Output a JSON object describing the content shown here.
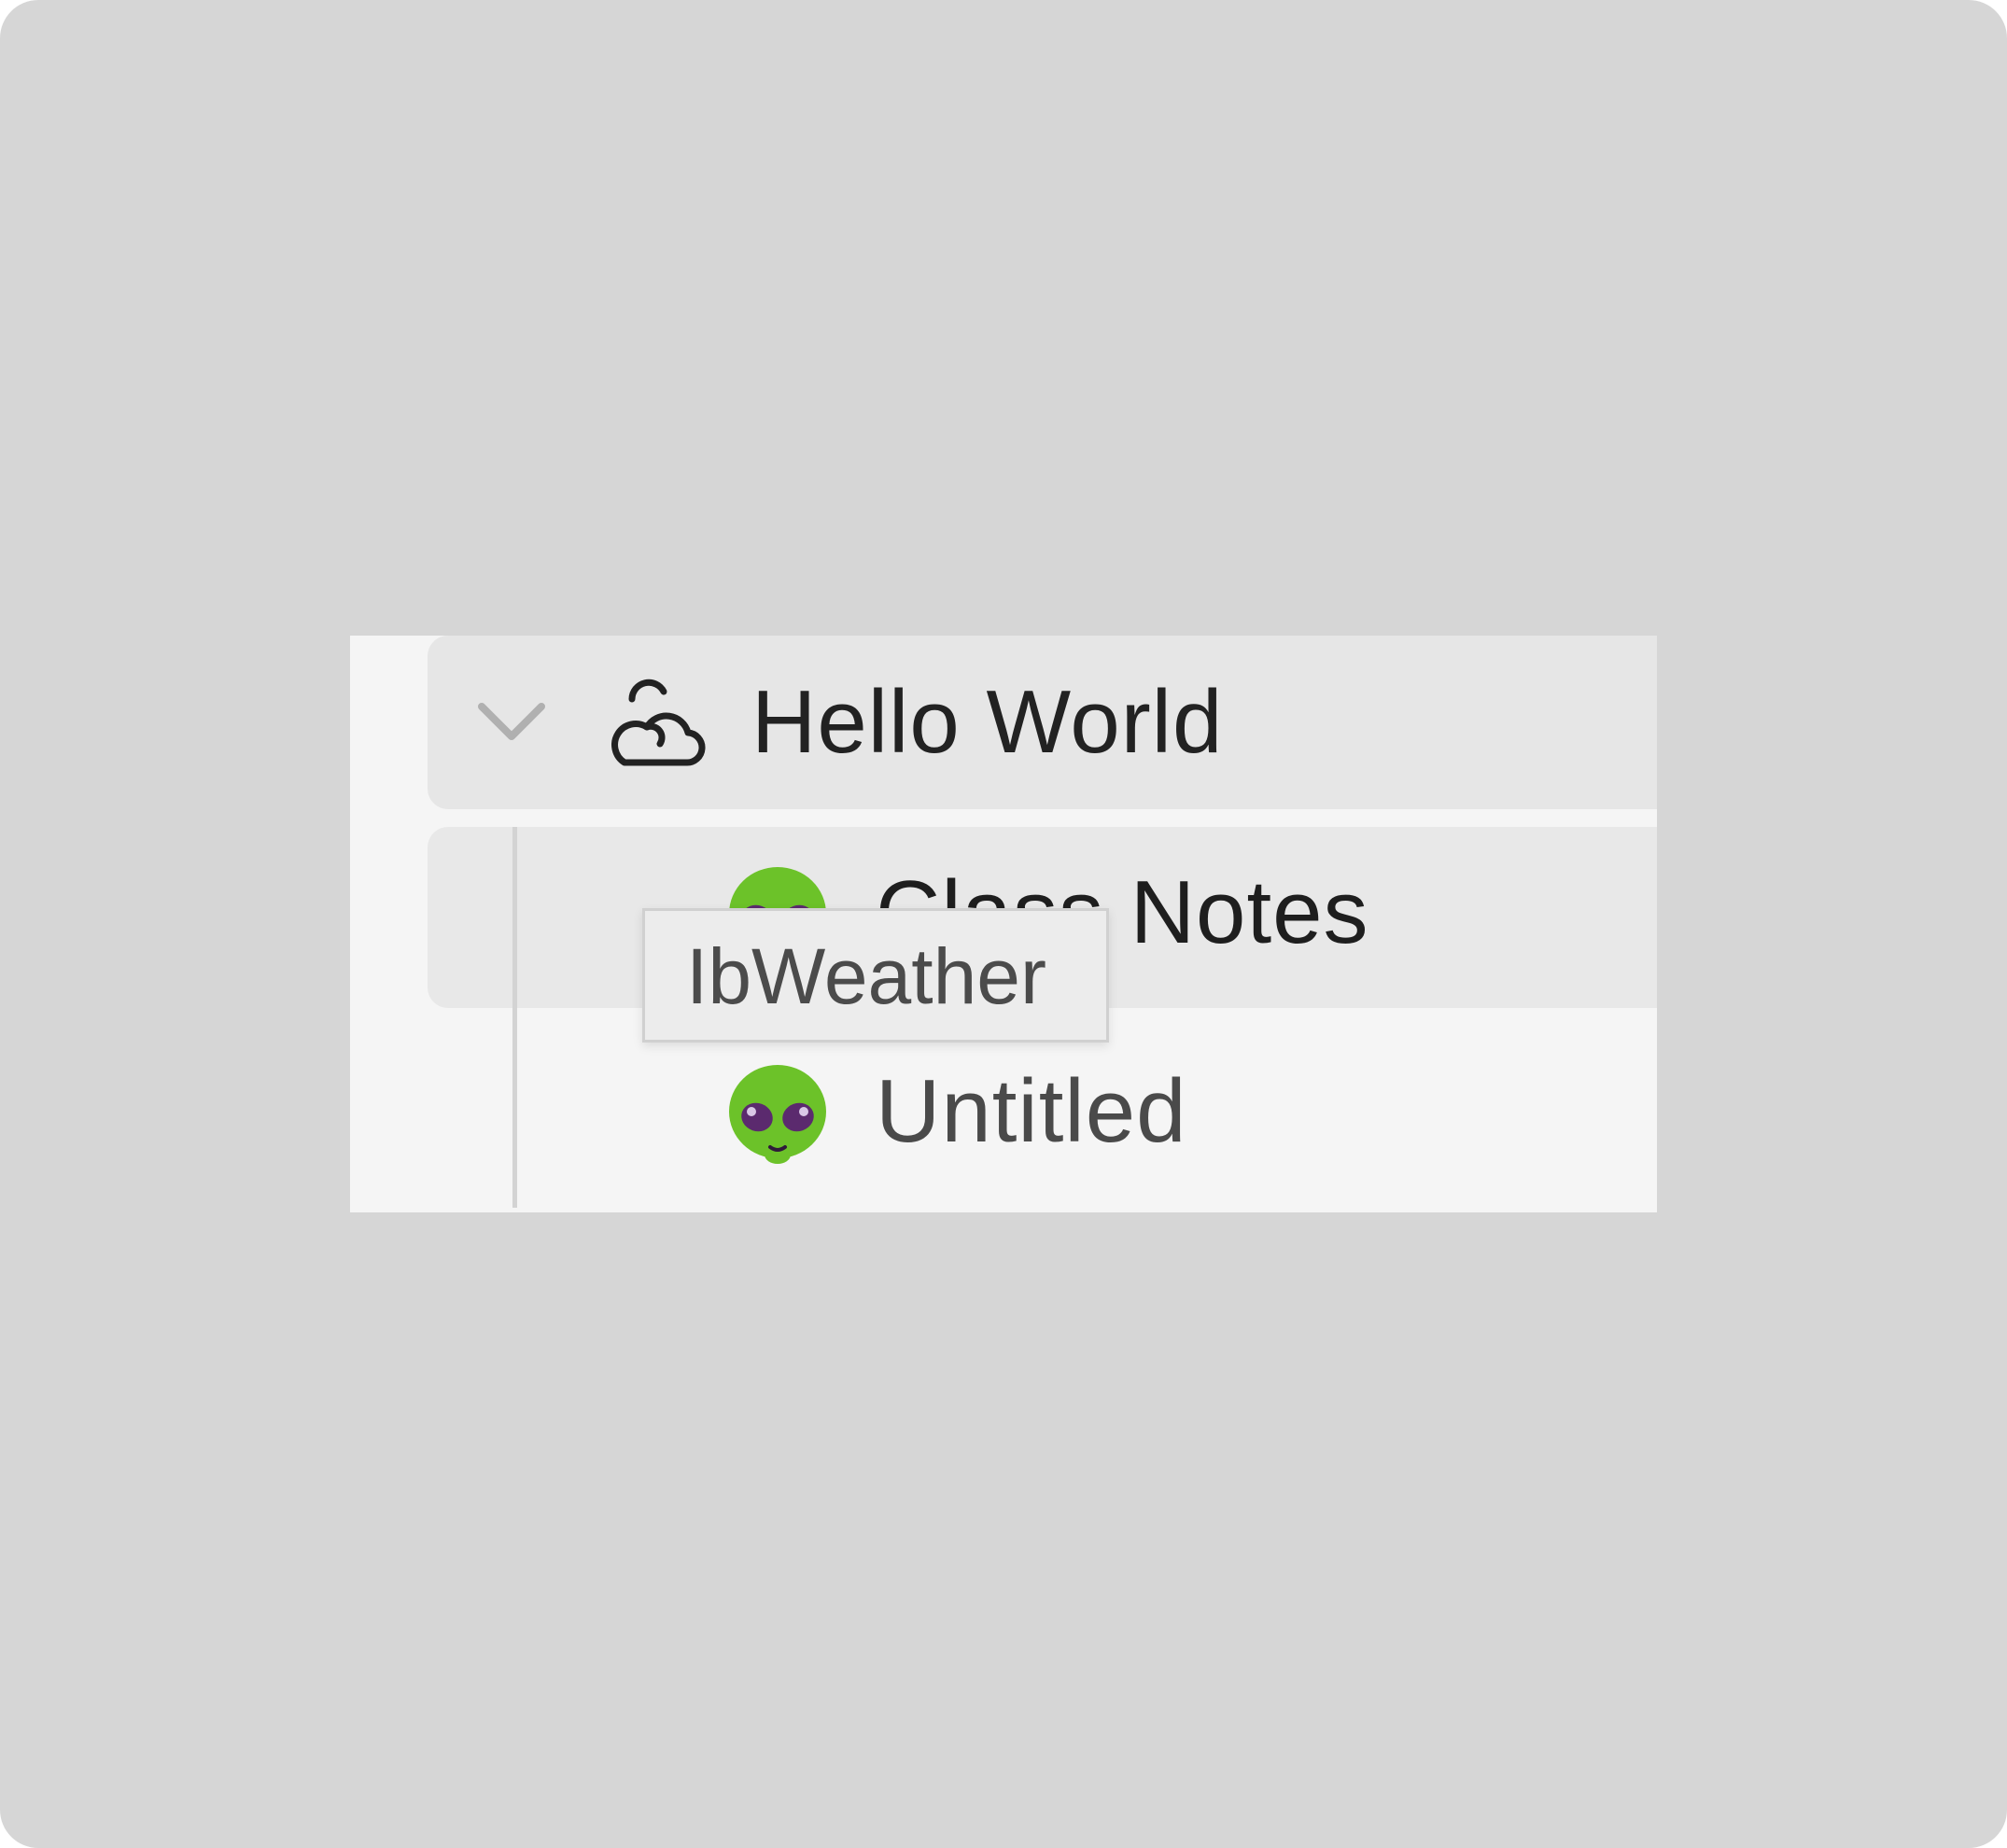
{
  "sidebar": {
    "workspace": {
      "title": "Hello World",
      "icon": "cloud-sun-icon",
      "toggle_icon": "chevron-down-icon",
      "expanded": true
    },
    "pages": [
      {
        "title": "Class Notes",
        "icon": "alien-emoji-icon",
        "hovered": true
      },
      {
        "title": "Untitled",
        "icon": "alien-emoji-icon",
        "hovered": false
      }
    ]
  },
  "tooltip": {
    "text": "IbWeather"
  },
  "colors": {
    "backdrop": "#d6d6d6",
    "panel": "#f5f5f5",
    "row_highlight": "#e6e6e6",
    "alien_green": "#6cc229",
    "alien_eyes": "#5b2a6e"
  }
}
